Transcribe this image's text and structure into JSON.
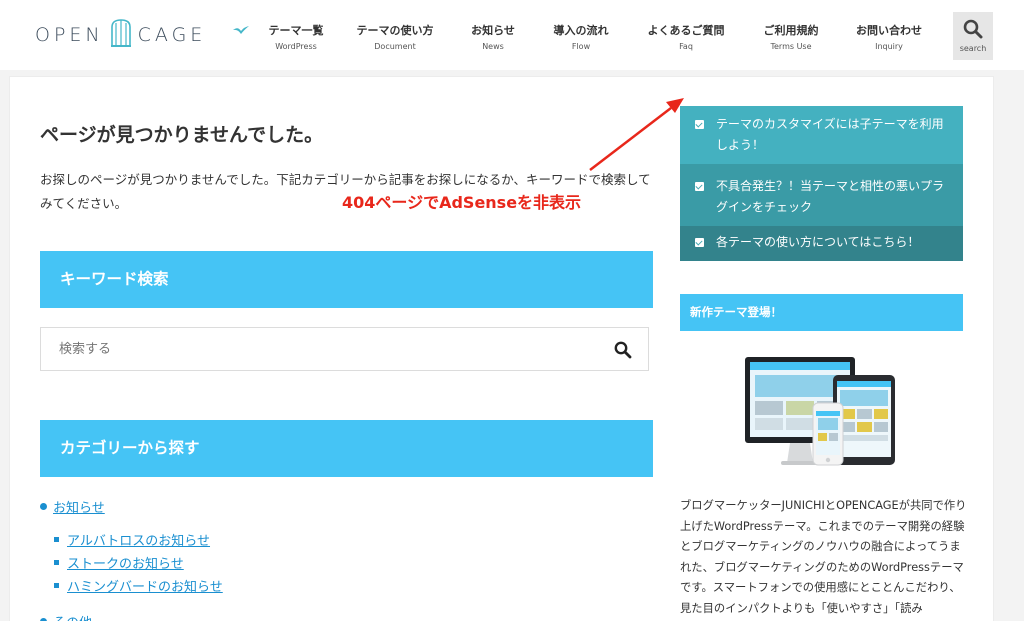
{
  "header": {
    "logo_left": "OPEN",
    "logo_right": "CAGE",
    "nav": [
      {
        "jp": "テーマ一覧",
        "en": "WordPress"
      },
      {
        "jp": "テーマの使い方",
        "en": "Document"
      },
      {
        "jp": "お知らせ",
        "en": "News"
      },
      {
        "jp": "導入の流れ",
        "en": "Flow"
      },
      {
        "jp": "よくあるご質問",
        "en": "Faq"
      },
      {
        "jp": "ご利用規約",
        "en": "Terms Use"
      },
      {
        "jp": "お問い合わせ",
        "en": "Inquiry"
      }
    ],
    "search_label": "search"
  },
  "main": {
    "title": "ページが見つかりませんでした。",
    "description": "お探しのページが見つかりませんでした。下記カテゴリーから記事をお探しになるか、キーワードで検索してみてください。",
    "annotation": "404ページでAdSenseを非表示",
    "keyword_heading": "キーワード検索",
    "search_placeholder": "検索する",
    "category_heading": "カテゴリーから探す",
    "categories": [
      {
        "label": "お知らせ",
        "children": [
          "アルバトロスのお知らせ",
          "ストークのお知らせ",
          "ハミングバードのお知らせ"
        ]
      },
      {
        "label": "その他",
        "children": []
      }
    ]
  },
  "sidebar": {
    "links": [
      {
        "label": "テーマのカスタマイズには子テーマを利用しよう！"
      },
      {
        "label": "不具合発生？！当テーマと相性の悪いプラグインをチェック"
      },
      {
        "label": "各テーマの使い方についてはこちら！"
      }
    ],
    "new_theme_heading": "新作テーマ登場！",
    "description": "ブログマーケッターJUNICHIとOPENCAGEが共同で作り上げたWordPressテーマ。これまでのテーマ開発の経験とブログマーケティングのノウハウの融合によってうまれた、ブログマーケティングのためのWordPressテーマです。スマートフォンでの使用感にとことんこだわり、見た目のインパクトよりも「使いやすさ」「読み"
  },
  "colors": {
    "accent": "#45c4f5",
    "sidebar_item_1": "#44b1c0",
    "sidebar_item_2": "#3a9ba6",
    "sidebar_item_3": "#33838c",
    "link": "#1a8fd0",
    "annotation": "#e8271b"
  },
  "icons": {
    "search": "search-icon",
    "checkbox": "checkbox-icon",
    "bird": "bird-icon"
  }
}
